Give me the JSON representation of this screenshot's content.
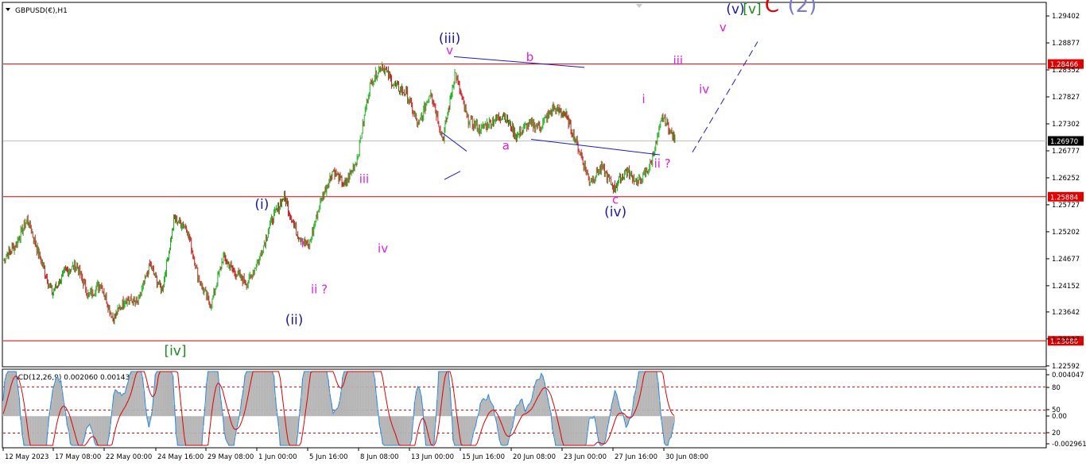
{
  "chart_data": [
    {
      "type": "candlestick",
      "title": "GBPUSD(€),H1",
      "y_ticks": [
        1.29402,
        1.28877,
        1.28352,
        1.27827,
        1.27302,
        1.26777,
        1.26252,
        1.25727,
        1.25202,
        1.24677,
        1.24152,
        1.23642,
        1.23117,
        1.22592
      ],
      "ylim": [
        1.2259,
        1.2965
      ],
      "x_ticks": [
        "12 May 2023",
        "17 May 08:00",
        "22 May 00:00",
        "24 May 16:00",
        "29 May 08:00",
        "1 Jun 00:00",
        "5 Jun 16:00",
        "8 Jun 08:00",
        "13 Jun 00:00",
        "15 Jun 16:00",
        "20 Jun 08:00",
        "23 Jun 00:00",
        "27 Jun 16:00",
        "30 Jun 08:00"
      ],
      "horizontal_levels": [
        {
          "value": 1.28466,
          "label": "1.28466",
          "color": "#e00000"
        },
        {
          "value": 1.25884,
          "label": "1.25884",
          "color": "#e00000"
        },
        {
          "value": 1.2308,
          "label": "1.23080",
          "color": "#e00000"
        }
      ],
      "current_price": {
        "value": 1.2697,
        "label": "1.26970"
      },
      "anchors": [
        1.2465,
        1.2495,
        1.2545,
        1.247,
        1.24,
        1.244,
        1.2455,
        1.2395,
        1.242,
        1.235,
        1.239,
        1.238,
        1.2455,
        1.2405,
        1.2545,
        1.253,
        1.243,
        1.2375,
        1.247,
        1.244,
        1.242,
        1.247,
        1.2545,
        1.259,
        1.252,
        1.249,
        1.258,
        1.264,
        1.261,
        1.2665,
        1.2805,
        1.2845,
        1.2805,
        1.279,
        1.2725,
        1.2795,
        1.27,
        1.283,
        1.274,
        1.272,
        1.2735,
        1.275,
        1.2705,
        1.273,
        1.2725,
        1.276,
        1.275,
        1.269,
        1.262,
        1.2645,
        1.2605,
        1.264,
        1.2615,
        1.265,
        1.2745,
        1.2697
      ],
      "wave_labels": [
        {
          "text": "(iii)",
          "price": 1.2888,
          "x": 0.428,
          "color": "#1a1aa0"
        },
        {
          "text": "v",
          "price": 1.2865,
          "x": 0.428,
          "color": "#e020e0"
        },
        {
          "text": "b",
          "price": 1.2852,
          "x": 0.505,
          "color": "#e020e0"
        },
        {
          "text": "a",
          "price": 1.268,
          "x": 0.482,
          "color": "#e020e0"
        },
        {
          "text": "c",
          "price": 1.2575,
          "x": 0.587,
          "color": "#e020e0"
        },
        {
          "text": "(iv)",
          "price": 1.255,
          "x": 0.587,
          "color": "#1a1aa0"
        },
        {
          "text": "i",
          "price": 1.277,
          "x": 0.614,
          "color": "#e020e0"
        },
        {
          "text": "ii ?",
          "price": 1.2645,
          "x": 0.632,
          "color": "#e020e0"
        },
        {
          "text": "iii",
          "price": 1.2845,
          "x": 0.647,
          "color": "#e020e0"
        },
        {
          "text": "iv",
          "price": 1.279,
          "x": 0.672,
          "color": "#e020e0"
        },
        {
          "text": "v",
          "price": 1.291,
          "x": 0.69,
          "color": "#e020e0"
        },
        {
          "text": "(v)",
          "price": 1.2945,
          "x": 0.702,
          "color": "#1a1aa0"
        },
        {
          "text": "[v]",
          "price": 1.2945,
          "x": 0.718,
          "color": "#1a8a1a"
        },
        {
          "text": "C",
          "price": 1.2948,
          "x": 0.737,
          "color": "#e00000"
        },
        {
          "text": "(2)",
          "price": 1.2948,
          "x": 0.766,
          "color": "#7a7ad0"
        },
        {
          "text": "(i)",
          "price": 1.2565,
          "x": 0.248,
          "color": "#1a1aa0"
        },
        {
          "text": "(ii)",
          "price": 1.234,
          "x": 0.279,
          "color": "#1a1aa0"
        },
        {
          "text": "i",
          "price": 1.249,
          "x": 0.287,
          "color": "#e020e0"
        },
        {
          "text": "ii ?",
          "price": 1.24,
          "x": 0.303,
          "color": "#e020e0"
        },
        {
          "text": "iii",
          "price": 1.2615,
          "x": 0.346,
          "color": "#e020e0"
        },
        {
          "text": "iv",
          "price": 1.248,
          "x": 0.364,
          "color": "#e020e0"
        },
        {
          "text": "[iv]",
          "price": 1.228,
          "x": 0.165,
          "color": "#1a8a1a"
        }
      ]
    },
    {
      "type": "line",
      "title": "MACD(12,26,9) 0.002060 0.001437",
      "y_ticks": [
        "0.004047",
        "80",
        "50",
        "0.00",
        "20",
        "-0.002961"
      ]
    }
  ]
}
